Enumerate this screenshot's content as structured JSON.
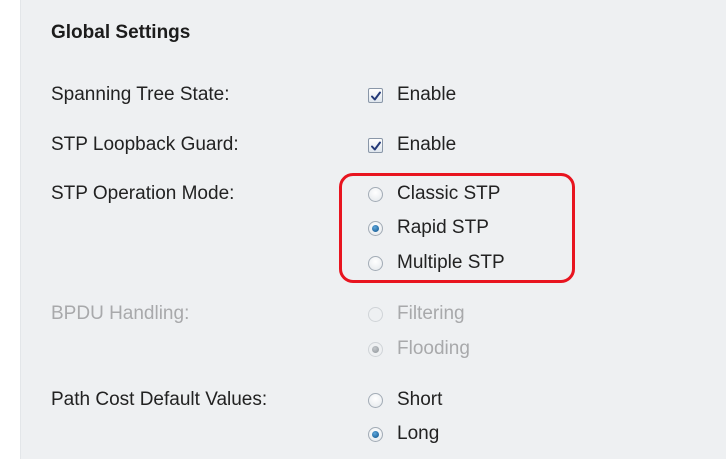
{
  "section": {
    "title": "Global Settings"
  },
  "spanning_tree_state": {
    "label": "Spanning Tree State:",
    "option": "Enable",
    "checked": true
  },
  "stp_loopback_guard": {
    "label": "STP Loopback Guard:",
    "option": "Enable",
    "checked": true
  },
  "stp_operation_mode": {
    "label": "STP Operation Mode:",
    "options": [
      "Classic STP",
      "Rapid STP",
      "Multiple STP"
    ],
    "selected": "Rapid STP"
  },
  "bpdu_handling": {
    "label": "BPDU Handling:",
    "options": [
      "Filtering",
      "Flooding"
    ],
    "selected": "Flooding",
    "disabled": true
  },
  "path_cost_default_values": {
    "label": "Path Cost Default Values:",
    "options": [
      "Short",
      "Long"
    ],
    "selected": "Long"
  },
  "colors": {
    "panel_background": "#eef0f2",
    "highlight_border": "#e8141f",
    "disabled_text": "#a8a9ab",
    "radio_selected": "#0b4f88"
  }
}
